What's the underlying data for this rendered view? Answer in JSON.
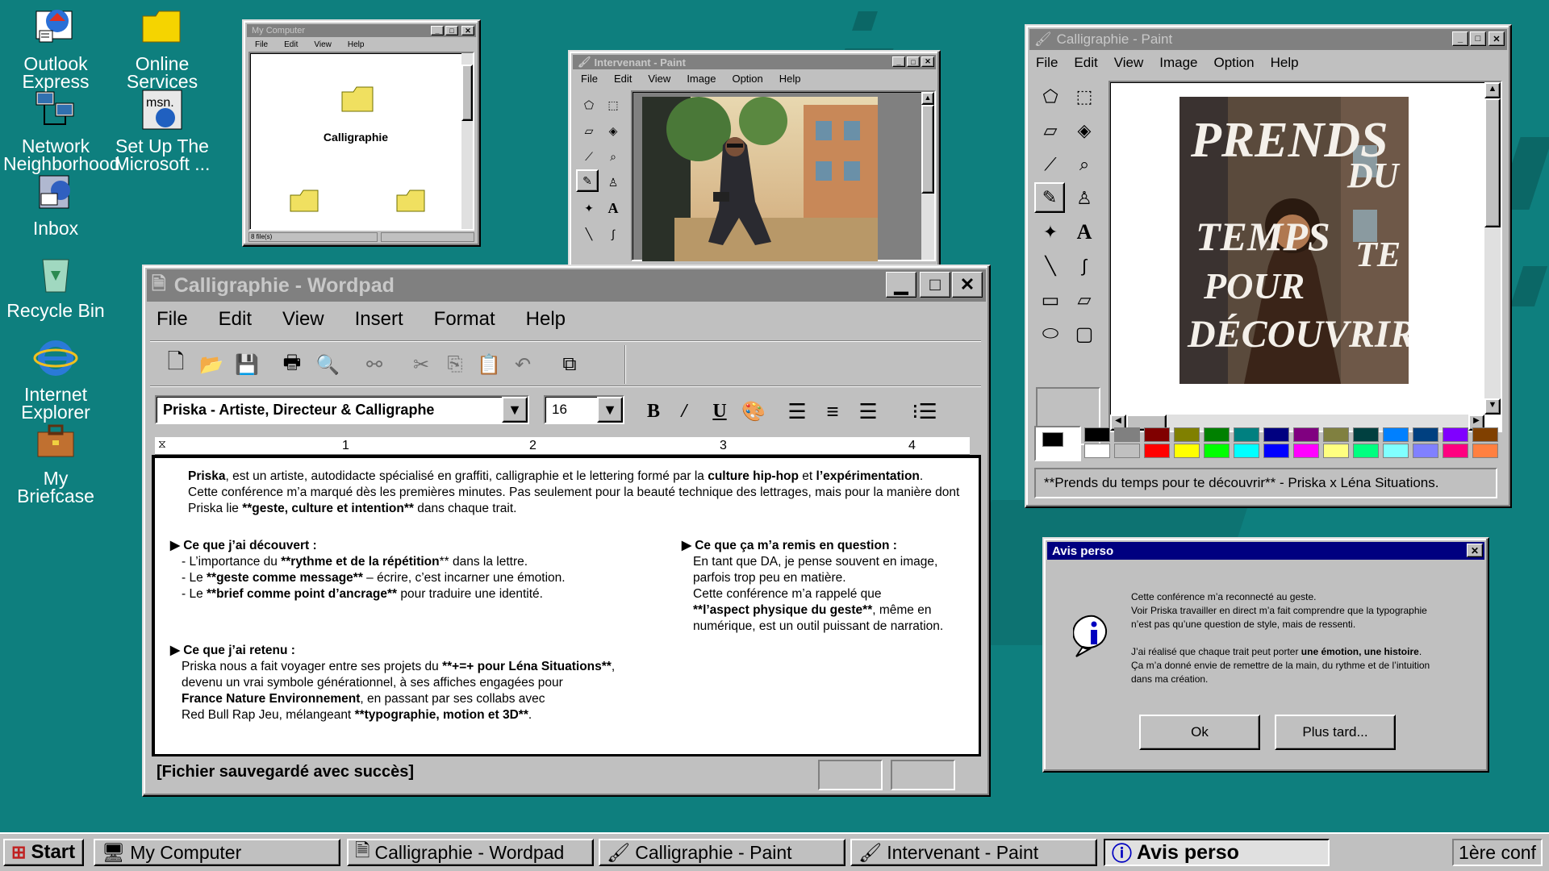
{
  "desktop": {
    "icons": [
      {
        "id": "outlook",
        "label": "Outlook Express"
      },
      {
        "id": "online",
        "label": "Online Services"
      },
      {
        "id": "network",
        "label": "Network Neighborhood"
      },
      {
        "id": "msn",
        "label": "Set Up The Microsoft ..."
      },
      {
        "id": "inbox",
        "label": "Inbox"
      },
      {
        "id": "recycle",
        "label": "Recycle Bin"
      },
      {
        "id": "ie",
        "label": "Internet Explorer"
      },
      {
        "id": "briefcase",
        "label": "My Briefcase"
      }
    ]
  },
  "mycomputer": {
    "title": "My Computer",
    "menu": [
      "File",
      "Edit",
      "View",
      "Help"
    ],
    "folder_label": "Calligraphie",
    "status": "8 file(s)"
  },
  "paint_small": {
    "title": "Intervenant - Paint",
    "menu": [
      "File",
      "Edit",
      "View",
      "Image",
      "Option",
      "Help"
    ]
  },
  "paint_large": {
    "title": "Calligraphie - Paint",
    "menu": [
      "File",
      "Edit",
      "View",
      "Image",
      "Option",
      "Help"
    ],
    "poster_text": [
      "PRENDS",
      "DU",
      "TEMPS",
      "TE",
      "POUR",
      "DÉCOUVRIR."
    ],
    "status": "**Prends du temps pour te découvrir** - Priska x Léna Situations.",
    "palette_top": [
      "#000000",
      "#808080",
      "#800000",
      "#808000",
      "#008000",
      "#008080",
      "#000080",
      "#800080",
      "#808040",
      "#004040",
      "#0080ff",
      "#004080",
      "#8000ff",
      "#804000"
    ],
    "palette_bottom": [
      "#ffffff",
      "#c0c0c0",
      "#ff0000",
      "#ffff00",
      "#00ff00",
      "#00ffff",
      "#0000ff",
      "#ff00ff",
      "#ffff80",
      "#00ff80",
      "#80ffff",
      "#8080ff",
      "#ff0080",
      "#ff8040"
    ]
  },
  "wordpad": {
    "title": "Calligraphie - Wordpad",
    "menu": [
      "File",
      "Edit",
      "View",
      "Insert",
      "Format",
      "Help"
    ],
    "font_name": "Priska - Artiste, Directeur & Calligraphe",
    "font_size": "16",
    "ruler": [
      "1",
      "2",
      "3",
      "4"
    ],
    "intro": {
      "p1a": "Priska",
      "p1b": ", est un artiste, autodidacte spécialisé en graffiti, calligraphie et le lettering formé par la ",
      "p1c": "culture hip-hop",
      "p1d": " et ",
      "p1e": "l’expérimentation",
      "p1f": ".",
      "p2": "Cette conférence m’a marqué dès les premières minutes.  Pas seulement pour la beauté technique des lettrages,  mais pour la manière dont",
      "p3a": "Priska lie ",
      "p3b": "**geste, culture et intention**",
      "p3c": "  dans chaque trait."
    },
    "decouvert": {
      "heading": "Ce que j’ai découvert :",
      "l1a": "- L’importance du ",
      "l1b": "**rythme et de la répétition",
      "l1c": "** dans la lettre.",
      "l2a": "- Le ",
      "l2b": "**geste comme message**",
      "l2c": " – écrire, c’est incarner une émotion.",
      "l3a": "- Le ",
      "l3b": "**brief comme point d’ancrage**",
      "l3c": " pour traduire une identité."
    },
    "retenu": {
      "heading": "Ce que j’ai retenu :",
      "l1a": "Priska nous a fait voyager entre ses projets du ",
      "l1b": "**+=+ pour Léna Situations**",
      "l1c": ",",
      "l2": "devenu un vrai symbole générationnel, à ses affiches engagées  pour",
      "l3a": "France Nature Environnement",
      "l3b": ", en passant par ses collabs avec",
      "l4a": "Red Bull Rap Jeu, mélangeant ",
      "l4b": "**typographie, motion et 3D**",
      "l4c": "."
    },
    "question": {
      "heading": "Ce que ça m’a remis en question :",
      "l1": "En tant que DA, je pense souvent en image,",
      "l2": "parfois trop peu en matière.",
      "l3": "Cette conférence m’a rappelé que",
      "l4a": "**l’aspect physique du geste**",
      "l4b": ", même en",
      "l5": "numérique, est un outil puissant de narration."
    },
    "status": "[Fichier sauvegardé avec succès]"
  },
  "dialog": {
    "title": "Avis perso",
    "l1": "Cette conférence m’a reconnecté au geste.",
    "l2": "Voir Priska travailler en direct m’a fait comprendre que la typographie",
    "l3": "n’est pas qu’une question de style, mais de ressenti.",
    "l4a": "J’ai réalisé que chaque trait peut porter ",
    "l4b": "une émotion, une histoire",
    "l4c": ".",
    "l5": "Ça m’a donné envie de remettre de la main, du rythme et de l’intuition",
    "l6": "dans ma création.",
    "ok": "Ok",
    "later": "Plus tard..."
  },
  "taskbar": {
    "start": "Start",
    "items": [
      "My Computer",
      "Calligraphie - Wordpad",
      "Calligraphie - Paint",
      "Intervenant - Paint",
      "Avis perso"
    ],
    "tray": "1ère conf"
  }
}
